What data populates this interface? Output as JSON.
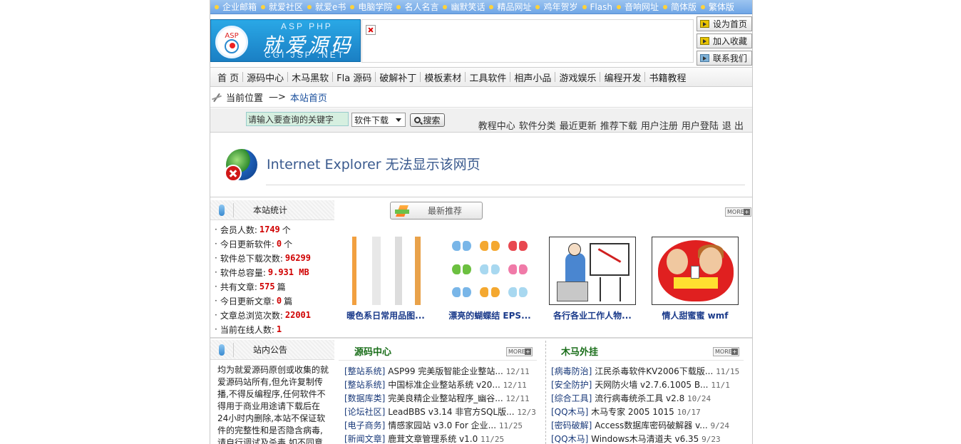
{
  "topbar": {
    "links": [
      "企业邮箱",
      "就爱社区",
      "就爱e书",
      "电脑学院",
      "名人名言",
      "幽默笑话",
      "精品网址",
      "鸡年贺岁",
      "Flash",
      "音响网址",
      "简体版",
      "繁体版"
    ]
  },
  "logo": {
    "name": "就爱源码",
    "tag_top": "ASP  PHP",
    "tag_bottom": "CGI  JSP  .NET",
    "badge": "ASP"
  },
  "side_buttons": [
    "设为首页",
    "加入收藏",
    "联系我们"
  ],
  "nav": [
    "首 页",
    "源码中心",
    "木马黑软",
    "Fla 源码",
    "破解补丁",
    "模板素材",
    "工具软件",
    "相声小品",
    "游戏娱乐",
    "编程开发",
    "书籍教程"
  ],
  "breadcrumb": {
    "label": "当前位置",
    "arrow": "—>",
    "current": "本站首页"
  },
  "search": {
    "input_value": "请输入要查询的关键字",
    "select_value": "软件下载",
    "button": "搜索"
  },
  "tools": [
    "教程中心",
    "软件分类",
    "最近更新",
    "推荐下载",
    "用户注册",
    "用户登陆",
    "退 出"
  ],
  "ie_error": "Internet Explorer 无法显示该网页",
  "stats": {
    "title": "本站统计",
    "rows": [
      {
        "label": "会员人数:",
        "value": "1749",
        "unit": "个"
      },
      {
        "label": "今日更新软件:",
        "value": "0",
        "unit": "个"
      },
      {
        "label": "软件总下载次数:",
        "value": "96299",
        "unit": ""
      },
      {
        "label": "软件总容量:",
        "value": "9.931 MB",
        "unit": ""
      },
      {
        "label": "共有文章:",
        "value": "575",
        "unit": "篇"
      },
      {
        "label": "今日更新文章:",
        "value": "0",
        "unit": "篇"
      },
      {
        "label": "文章总浏览次数:",
        "value": "22001",
        "unit": ""
      },
      {
        "label": "当前在线人数:",
        "value": "1",
        "unit": ""
      }
    ]
  },
  "notice": {
    "title": "站内公告",
    "text": "均为就爱源码原创或收集的就爱源码站所有,但允许复制传播,不得反编程序,任何软件不得用于商业用途请下载后在24小时内删除,本站不保证软件的完整性和是否隐含病毒,请自行调试及杀毒,如不同意"
  },
  "recommend": {
    "title": "最新推荐",
    "more": "MORE",
    "items": [
      {
        "caption": "暖色系日常用品图...",
        "icon": "lamps-thumbnail"
      },
      {
        "caption": "漂亮的蝴蝶结 EPS...",
        "icon": "bows-thumbnail"
      },
      {
        "caption": "各行各业工作人物...",
        "icon": "business-clipart-thumbnail"
      },
      {
        "caption": "情人甜蜜蜜 wmf",
        "icon": "lovers-heart-thumbnail"
      }
    ]
  },
  "source_center": {
    "title": "源码中心",
    "more": "MORE",
    "items": [
      {
        "cat": "[整站系统]",
        "title": "ASP99 完美版智能企业整站...",
        "date": "12/11"
      },
      {
        "cat": "[整站系统]",
        "title": "中国标准企业整站系统 v20...",
        "date": "12/11"
      },
      {
        "cat": "[数据库类]",
        "title": "完美良精企业整站程序_幽谷...",
        "date": "12/11"
      },
      {
        "cat": "[论坛社区]",
        "title": "LeadBBS v3.14 非官方SQL版...",
        "date": "12/3"
      },
      {
        "cat": "[电子商务]",
        "title": "情感家园站 v3.0 For 企业...",
        "date": "11/25"
      },
      {
        "cat": "[新闻文章]",
        "title": "鹿茸文章管理系统 v1.0",
        "date": "11/25"
      }
    ]
  },
  "trojan": {
    "title": "木马外挂",
    "more": "MORE",
    "items": [
      {
        "cat": "[病毒防治]",
        "title": "江民杀毒软件KV2006下载版...",
        "date": "11/15"
      },
      {
        "cat": "[安全防护]",
        "title": "天网防火墙 v2.7.6.1005 B...",
        "date": "11/1"
      },
      {
        "cat": "[综合工具]",
        "title": "流行病毒统杀工具 v2.8",
        "date": "10/24"
      },
      {
        "cat": "[QQ木马]",
        "title": "木马专家 2005 1015",
        "date": "10/17"
      },
      {
        "cat": "[密码破解]",
        "title": "Access数据库密码破解器 v...",
        "date": "9/24"
      },
      {
        "cat": "[QQ木马]",
        "title": "Windows木马清道夫 v6.35",
        "date": "9/23"
      }
    ]
  }
}
